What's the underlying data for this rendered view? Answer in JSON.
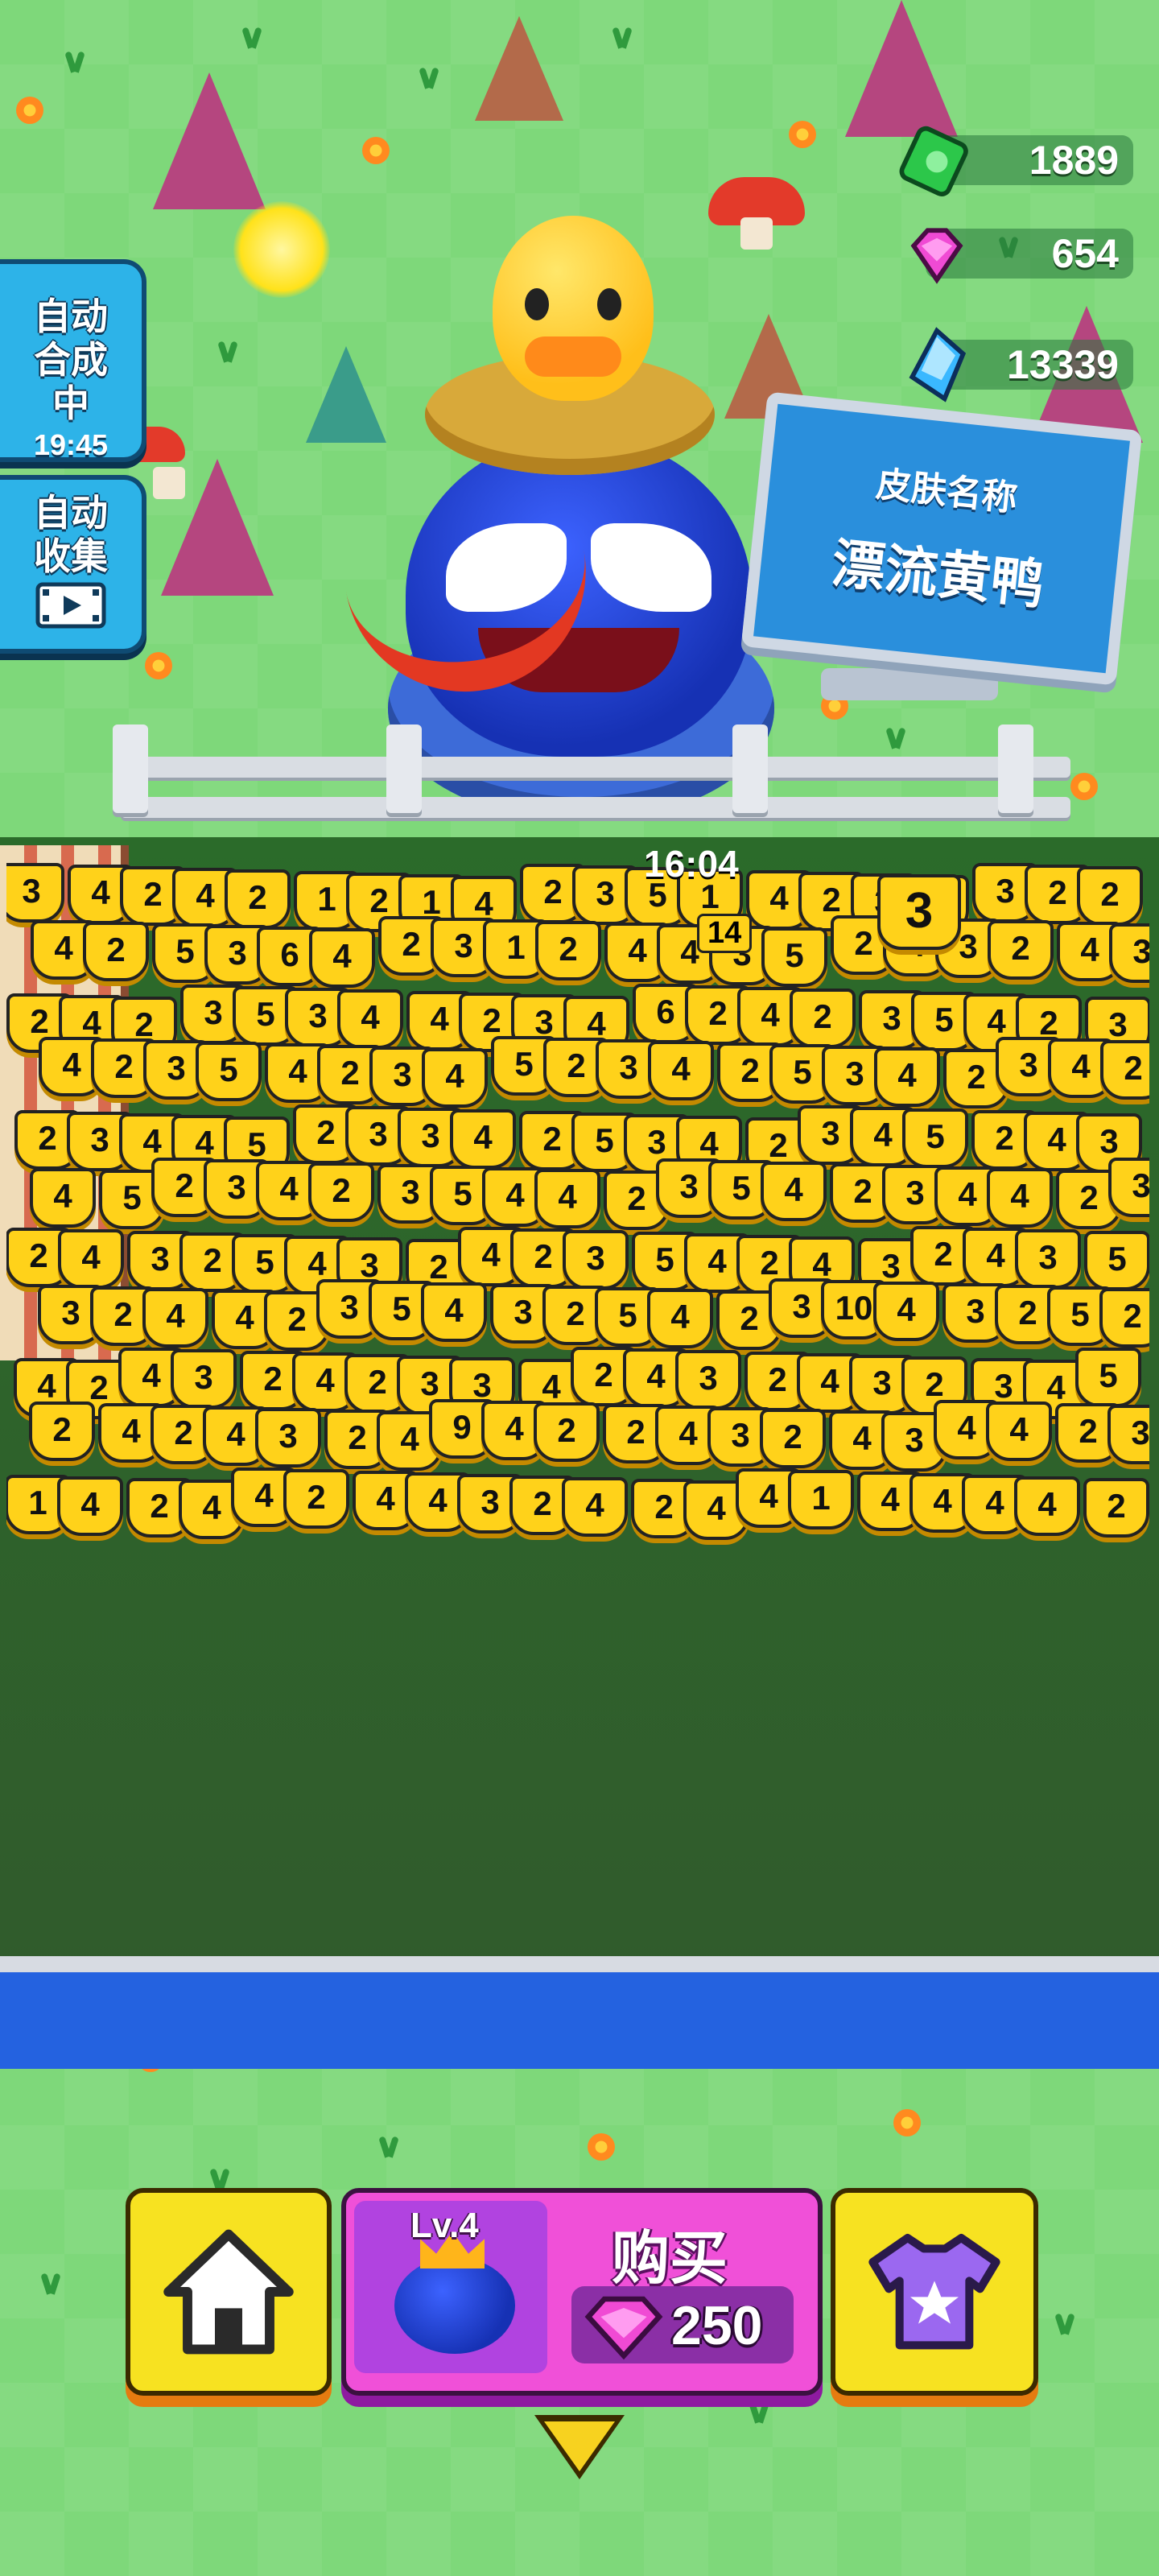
{
  "hud": {
    "cash": "1889",
    "gems": "654",
    "crystals": "13339"
  },
  "side_buttons": {
    "auto_merge_label": "自动合成中",
    "auto_merge_time": "19:45",
    "auto_collect_label": "自动收集"
  },
  "billboard": {
    "title": "皮肤名称",
    "name": "漂流黄鸭"
  },
  "coin_area": {
    "timer": "16:04",
    "chip_value": "14",
    "highlight_value": "3"
  },
  "bottom_bar": {
    "level": "Lv.4",
    "buy_label": "购买",
    "buy_price": "250"
  },
  "colors": {
    "grass": "#7ed87a",
    "coin": "#ffd21a",
    "buy_button": "#f050d8",
    "yellow_button": "#f7e221"
  },
  "coins_values": [
    "3",
    "4",
    "2",
    "4",
    "2",
    "1",
    "2",
    "1",
    "4",
    "2",
    "3",
    "5",
    "1",
    "4",
    "2",
    "3",
    "4",
    "3",
    "2",
    "2",
    "4",
    "2",
    "5",
    "3",
    "6",
    "4",
    "2",
    "3",
    "1",
    "2",
    "4",
    "4",
    "3",
    "5",
    "2",
    "4",
    "3",
    "2",
    "4",
    "3",
    "2",
    "4",
    "2",
    "3",
    "5",
    "3",
    "4",
    "4",
    "2",
    "3",
    "4",
    "6",
    "2",
    "4",
    "2",
    "3",
    "5",
    "4",
    "2",
    "3",
    "4",
    "2",
    "3",
    "5",
    "4",
    "2",
    "3",
    "4",
    "5",
    "2",
    "3",
    "4",
    "2",
    "5",
    "3",
    "4",
    "2",
    "3",
    "4",
    "2",
    "2",
    "3",
    "4",
    "4",
    "5",
    "2",
    "3",
    "3",
    "4",
    "2",
    "5",
    "3",
    "4",
    "2",
    "3",
    "4",
    "5",
    "2",
    "4",
    "3",
    "4",
    "5",
    "2",
    "3",
    "4",
    "2",
    "3",
    "5",
    "4",
    "4",
    "2",
    "3",
    "5",
    "4",
    "2",
    "3",
    "4",
    "4",
    "2",
    "3",
    "2",
    "4",
    "3",
    "2",
    "5",
    "4",
    "3",
    "2",
    "4",
    "2",
    "3",
    "5",
    "4",
    "2",
    "4",
    "3",
    "2",
    "4",
    "3",
    "5",
    "3",
    "2",
    "4",
    "4",
    "2",
    "3",
    "5",
    "4",
    "3",
    "2",
    "5",
    "4",
    "2",
    "3",
    "10",
    "4",
    "3",
    "2",
    "5",
    "2",
    "4",
    "2",
    "4",
    "3",
    "2",
    "4",
    "2",
    "3",
    "3",
    "4",
    "2",
    "4",
    "3",
    "2",
    "4",
    "3",
    "2",
    "3",
    "4",
    "5",
    "2",
    "4",
    "2",
    "4",
    "3",
    "2",
    "4",
    "9",
    "4",
    "2",
    "2",
    "4",
    "3",
    "2",
    "4",
    "3",
    "4",
    "4",
    "2",
    "3",
    "1",
    "4",
    "2",
    "4",
    "4",
    "2",
    "4",
    "4",
    "3",
    "2",
    "4",
    "2",
    "4",
    "4",
    "1",
    "4",
    "4",
    "4",
    "4",
    "2"
  ]
}
